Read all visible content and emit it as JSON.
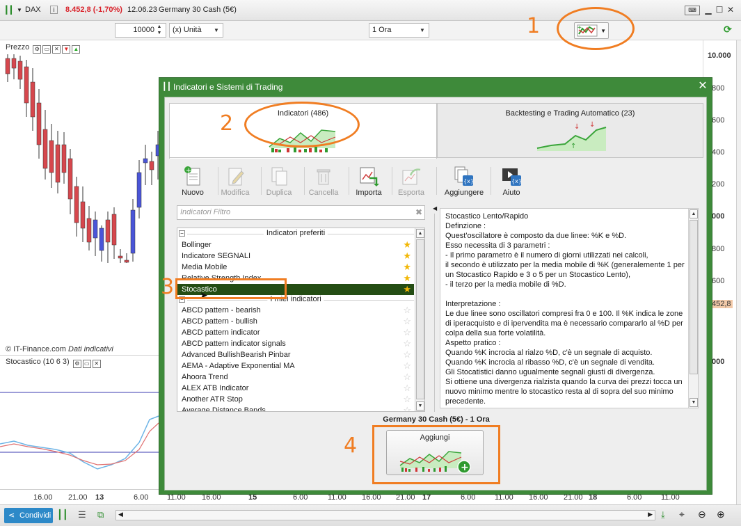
{
  "top_bar": {
    "symbol": "DAX",
    "price_change": "8.452,8 (-1,70%)",
    "date": "12.06.23",
    "instrument": "Germany 30 Cash (5€)"
  },
  "toolbar": {
    "quantity": "10000",
    "unit": "(x) Unità",
    "timeframe": "1 Ora"
  },
  "price_panel": {
    "label": "Prezzo",
    "credit": "© IT-Finance.com",
    "credit_note": "Dati indicativi",
    "scale_labels": [
      "10.000",
      "800",
      "600",
      "400",
      "200",
      "000",
      "800",
      "600",
      "452,8",
      "000"
    ]
  },
  "stoch_panel": {
    "label": "Stocastico (10 6 3)"
  },
  "time_axis": {
    "labels": [
      "16.00",
      "21.00",
      "13",
      "6.00",
      "11.00",
      "16.00",
      "15",
      "6.00",
      "11.00",
      "16.00",
      "21.00",
      "17",
      "6.00",
      "11.00",
      "16.00",
      "21.00",
      "18",
      "6.00",
      "11.00"
    ]
  },
  "bottom_bar": {
    "share_label": "Condividi"
  },
  "dialog": {
    "title": "Indicatori e Sistemi di Trading",
    "tabs": [
      {
        "label": "Indicatori (486)"
      },
      {
        "label": "Backtesting e Trading Automatico (23)"
      }
    ],
    "tools": [
      {
        "label": "Nuovo",
        "icon": "new-file-icon"
      },
      {
        "label": "Modifica",
        "icon": "edit-icon"
      },
      {
        "label": "Duplica",
        "icon": "duplicate-icon"
      },
      {
        "label": "Cancella",
        "icon": "trash-icon"
      },
      {
        "label": "Importa",
        "icon": "import-icon"
      },
      {
        "label": "Esporta",
        "icon": "export-icon"
      },
      {
        "label": "Aggiungere",
        "icon": "add-variable-icon"
      },
      {
        "label": "Aiuto",
        "icon": "help-video-icon"
      }
    ],
    "filter_placeholder": "Indicatori Filtro",
    "favorites_header": "Indicatori preferiti",
    "favorites": [
      "Bollinger",
      "Indicatore SEGNALI",
      "Media Mobile",
      "Relative Strength Index",
      "Stocastico"
    ],
    "selected": "Stocastico",
    "my_header": "I miei indicatori",
    "indicators": [
      "ABCD pattern - bearish",
      "ABCD pattern - bullish",
      "ABCD pattern indicator",
      "ABCD pattern indicator signals",
      "Advanced BullishBearish Pinbar",
      "AEMA - Adaptive Exponential MA",
      "Ahoora Trend",
      "ALEX ATB Indicator",
      "Another ATR Stop",
      "Average Distance Bands"
    ],
    "description": "Stocastico Lento/Rapido\nDefinzione :\nQuest'oscillatore è composto da due linee: %K e %D.\nEsso necessita di 3 parametri :\n- Il primo parametro è il numero di giorni utilizzati nei calcoli,\nil secondo è utilizzato per la media mobile di %K (generalemente 1 per un Stocastico Rapido e 3 o 5 per un Stocastico Lento),\n- il terzo per la media mobile di %D.\n\nInterpretazione :\nLe due linee sono oscillatori compresi fra 0 e 100. Il %K indica le zone di iperacquisto e di ipervendita ma è necessario compararlo al %D per colpa della sua forte volatilità.\nAspetto pratico :\nQuando %K incrocia al rialzo %D, c'è un segnale di acquisto.\nQuando %K incrocia al ribasso %D, c'è un segnale di vendita.\nGli Stocatistici danno ugualmente segnali giusti di divergenza.\nSi ottiene una divergenza rialzista quando la curva dei prezzi tocca un nuovo minimo mentre lo stocastico resta al di sopra del suo minimo precedente.",
    "add_caption": "Germany 30 Cash (5€) - 1 Ora",
    "add_button": "Aggiungi"
  },
  "annotations": [
    "1",
    "2",
    "3",
    "4"
  ],
  "colors": {
    "accent_orange": "#f07d22",
    "dialog_green": "#3e8a3a",
    "selected_row": "#244d14",
    "bull_candle": "#4a55d8",
    "bear_candle": "#d6474d"
  }
}
